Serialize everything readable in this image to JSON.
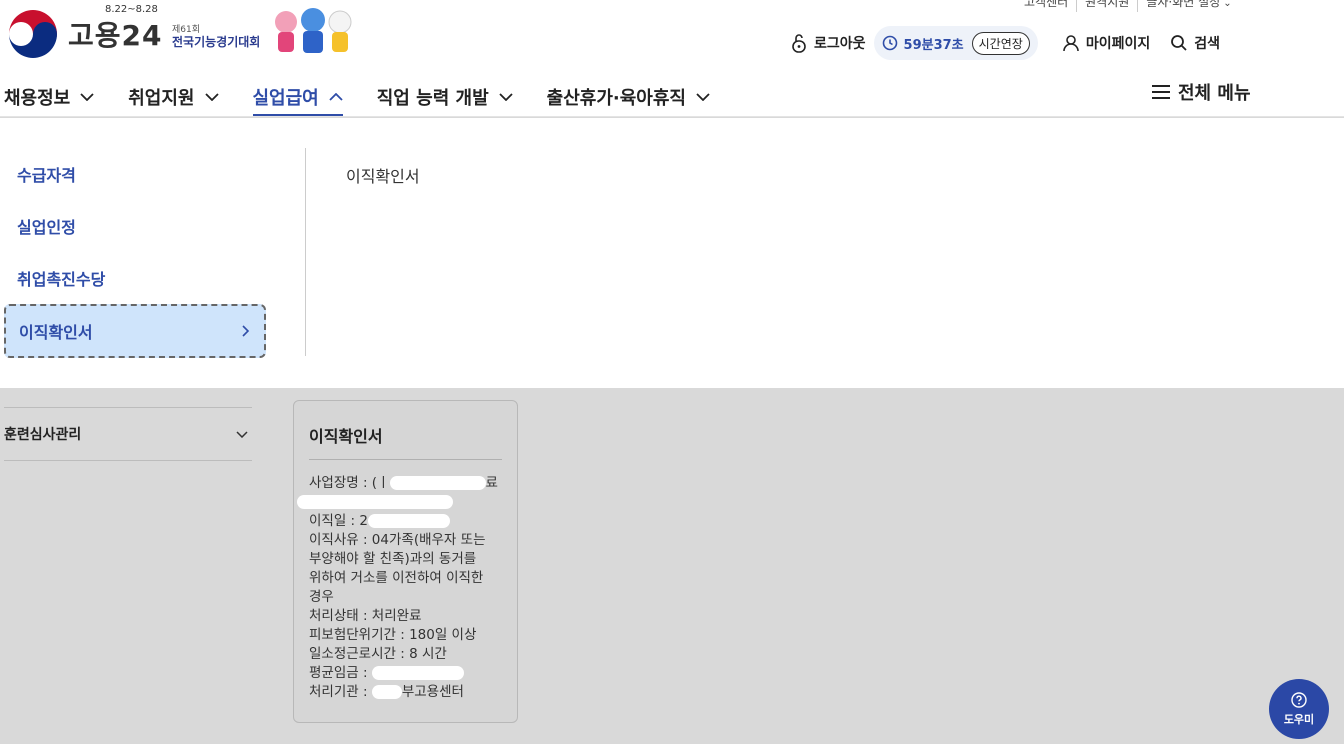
{
  "util_links": [
    "고객센터",
    "원격지원",
    "글자·화면 설정"
  ],
  "logo": {
    "text": "고용24"
  },
  "event": {
    "date": "8.22~8.28",
    "sub": "제61회",
    "title": "전국기능경기대회"
  },
  "actions": {
    "logout": "로그아웃",
    "timer": "59분37초",
    "extend": "시간연장",
    "mypage": "마이페이지",
    "search": "검색"
  },
  "gnb": [
    "채용정보",
    "취업지원",
    "실업급여",
    "직업 능력 개발",
    "출산휴가·육아휴직"
  ],
  "all_menu": "전체 메뉴",
  "submenu": [
    "수급자격",
    "실업인정",
    "취업촉진수당",
    "이직확인서"
  ],
  "third_menu": "이직확인서",
  "side_menu": "훈련심사관리",
  "card": {
    "title": "이직확인서",
    "workplace": "사업장명 : (ㅣ",
    "workplace_tail": "료",
    "leave_date": "이직일 : 2",
    "reason": "이직사유 : 04가족(배우자 또는 부양해야 할 친족)과의 동거를 위하여 거소를 이전하여 이직한 경우",
    "status": "처리상태 : 처리완료",
    "insured_period": "피보험단위기간 : 180일 이상",
    "work_hours": "일소정근로시간 : 8 시간",
    "avg_wage": "평균임금 :",
    "agency": "처리기관 :",
    "agency_tail": "부고용센터"
  },
  "help": {
    "label": "도우미"
  },
  "colors": {
    "primary": "#2f4da8",
    "selected_bg": "#cfe4fb",
    "overlay": "#d9d9d9"
  }
}
